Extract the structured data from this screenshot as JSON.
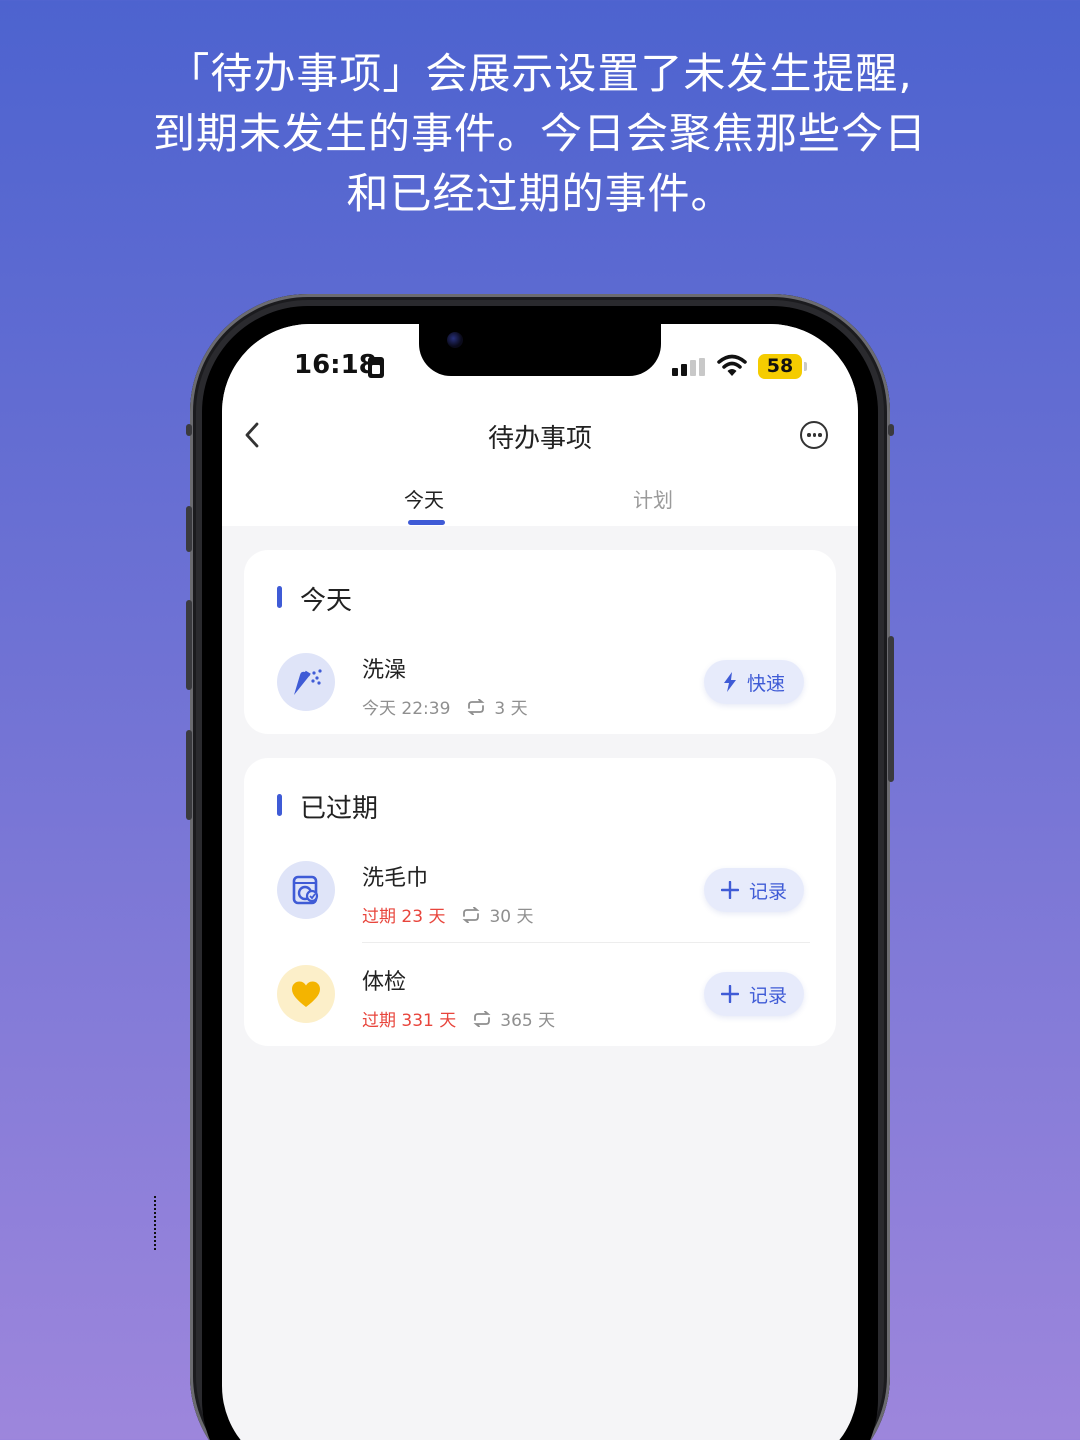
{
  "caption": {
    "line1": "「待办事项」会展示设置了未发生提醒,",
    "line2": "到期未发生的事件。今日会聚焦那些今日",
    "line3": "和已经过期的事件。"
  },
  "status_bar": {
    "time": "16:18",
    "battery": "58",
    "sim_icon": "sim-card-icon",
    "signal_icon": "cellular-signal-icon",
    "wifi_icon": "wifi-icon"
  },
  "nav": {
    "title": "待办事项",
    "back_icon": "chevron-left-icon",
    "more_icon": "more-options-icon"
  },
  "tabs": [
    {
      "label": "今天",
      "active": true
    },
    {
      "label": "计划",
      "active": false
    }
  ],
  "sections": {
    "today": {
      "title": "今天",
      "items": [
        {
          "name": "洗澡",
          "icon": "shower-icon",
          "due": "今天 22:39",
          "repeat": "3 天",
          "action": "快速",
          "action_icon": "lightning-icon"
        }
      ]
    },
    "overdue": {
      "title": "已过期",
      "items": [
        {
          "name": "洗毛巾",
          "icon": "washing-machine-icon",
          "due": "过期 23 天",
          "repeat": "30 天",
          "action": "记录",
          "action_icon": "plus-icon"
        },
        {
          "name": "体检",
          "icon": "heart-icon",
          "due": "过期 331 天",
          "repeat": "365 天",
          "action": "记录",
          "action_icon": "plus-icon"
        }
      ]
    }
  },
  "colors": {
    "accent": "#3f5bd6",
    "overdue_red": "#e8453c",
    "pill_bg": "#e7ebfb",
    "background_top": "#4d63cf",
    "background_bottom": "#9d86dc"
  }
}
